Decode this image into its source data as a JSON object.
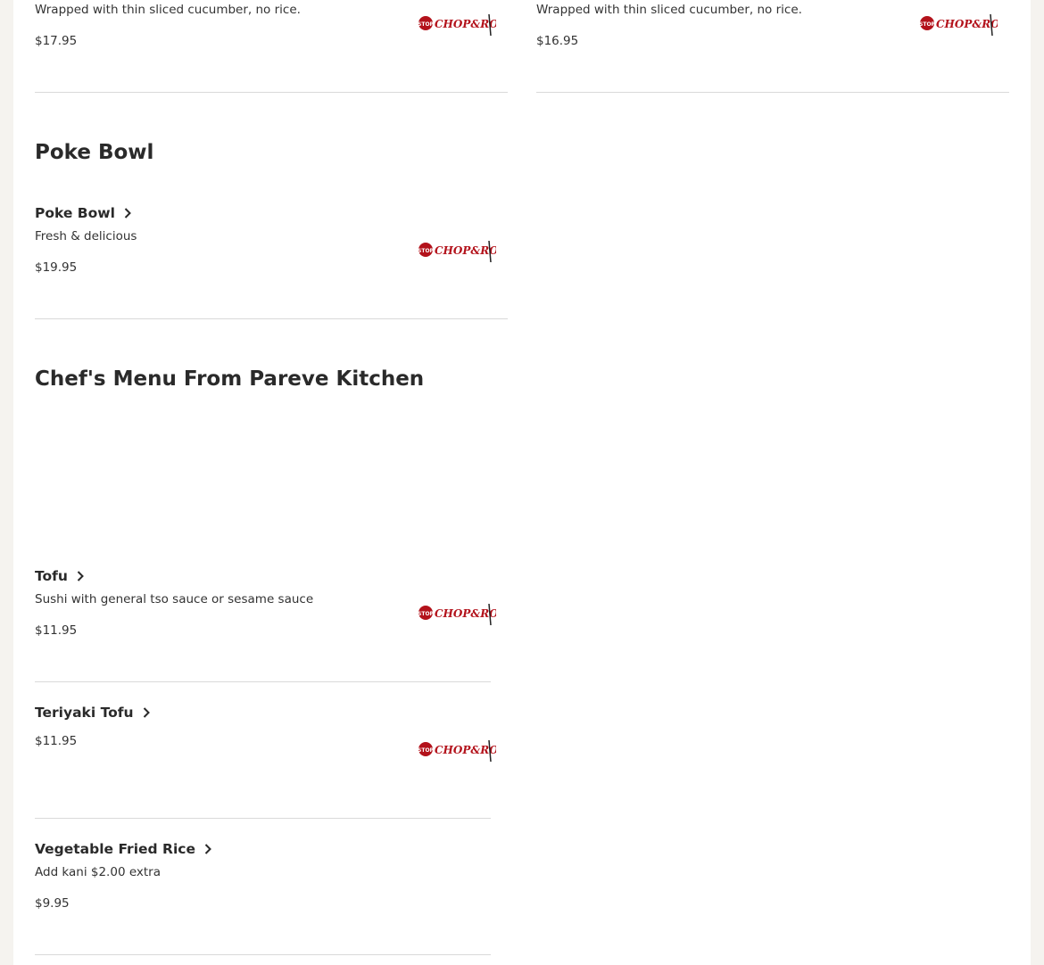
{
  "top_items": [
    {
      "desc": "Wrapped with thin sliced cucumber, no rice.",
      "price": "$17.95"
    },
    {
      "desc": "Wrapped with thin sliced cucumber, no rice.",
      "price": "$16.95"
    }
  ],
  "sections": [
    {
      "title": "Poke Bowl",
      "items": [
        {
          "name": "Poke Bowl",
          "desc": "Fresh & delicious",
          "price": "$19.95"
        }
      ]
    },
    {
      "title": "Chef's Menu From Pareve Kitchen",
      "items": [
        {
          "name": "Tofu",
          "desc": "Sushi with general tso sauce or sesame sauce",
          "price": "$11.95"
        },
        {
          "name": "Teriyaki Tofu",
          "desc": "",
          "price": "$11.95"
        },
        {
          "name": "Vegetable Fried Rice",
          "desc": "Add kani $2.00 extra",
          "price": "$9.95"
        }
      ]
    }
  ],
  "logo": {
    "text": "STOP CHOP & ROLL",
    "color": "#b3121b",
    "icon": "stop-chop-roll-logo"
  }
}
